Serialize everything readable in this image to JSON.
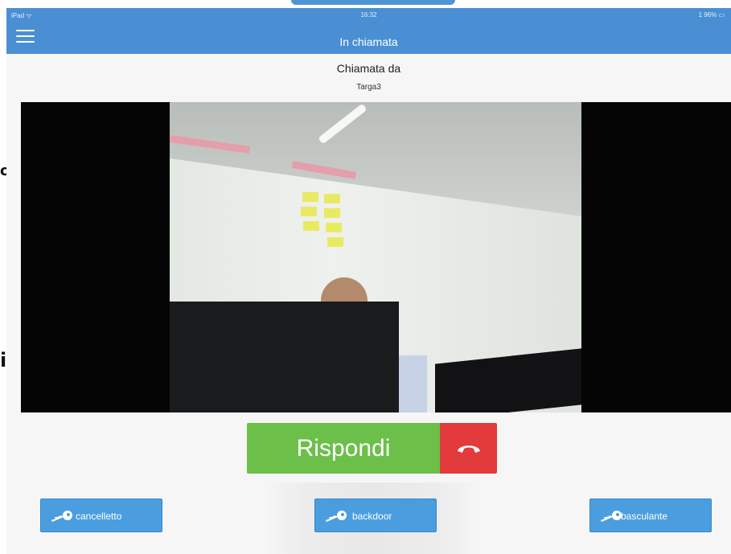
{
  "status_bar": {
    "device": "iPad ᯤ",
    "time": "16:32",
    "battery": "1 96% ▭"
  },
  "header": {
    "title": "In chiamata",
    "menu_icon": "hamburger-menu-icon"
  },
  "caller": {
    "heading": "Chiamata da",
    "name": "Targa3"
  },
  "call_actions": {
    "answer_label": "Rispondi",
    "hangup_icon": "phone-hangup-icon"
  },
  "door_buttons": [
    {
      "label": "cancelletto",
      "icon": "key-icon"
    },
    {
      "label": "backdoor",
      "icon": "key-icon"
    },
    {
      "label": "basculante",
      "icon": "key-icon"
    }
  ],
  "edge_text": {
    "top": "o",
    "bottom": "i"
  },
  "colors": {
    "header": "#4a8fd4",
    "answer": "#6cc04a",
    "hangup": "#e33b3b",
    "key_button": "#4a9ee0"
  }
}
